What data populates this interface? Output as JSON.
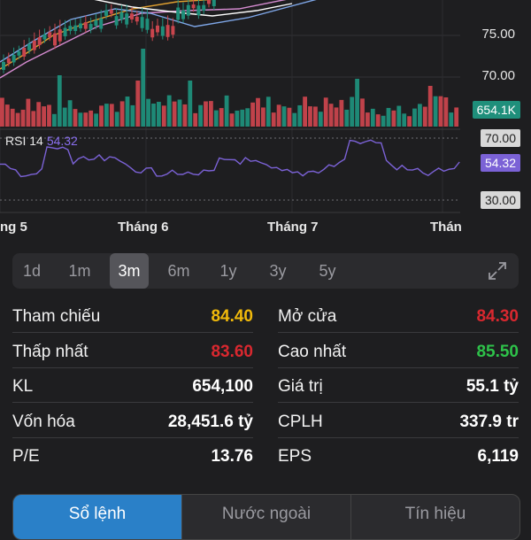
{
  "colors": {
    "up": "#1f8f7b",
    "down": "#c9454d",
    "rsi": "#7b62d6",
    "ref_yellow": "#f0b90b",
    "down_text": "#d9282f",
    "up_text": "#2ec24a",
    "active_blue": "#2a80c8"
  },
  "price_axis": {
    "labels": [
      "75.00",
      "70.00"
    ]
  },
  "volume_tag": "654.1K",
  "rsi": {
    "label": "RSI 14",
    "value": "54.32",
    "level_high": "70.00",
    "level_low": "30.00"
  },
  "months": [
    "ng 5",
    "Tháng 6",
    "Tháng 7",
    "Thán"
  ],
  "periods": [
    "1d",
    "1m",
    "3m",
    "6m",
    "1y",
    "3y",
    "5y"
  ],
  "active_period": "3m",
  "stats_left": [
    {
      "label": "Tham chiếu",
      "value": "84.40",
      "tone": "yellow"
    },
    {
      "label": "Thấp nhất",
      "value": "83.60",
      "tone": "red"
    },
    {
      "label": "KL",
      "value": "654,100",
      "tone": "white"
    },
    {
      "label": "Vốn hóa",
      "value": "28,451.6 tỷ",
      "tone": "white"
    },
    {
      "label": "P/E",
      "value": "13.76",
      "tone": "white"
    }
  ],
  "stats_right": [
    {
      "label": "Mở cửa",
      "value": "84.30",
      "tone": "red"
    },
    {
      "label": "Cao nhất",
      "value": "85.50",
      "tone": "green"
    },
    {
      "label": "Giá trị",
      "value": "55.1 tỷ",
      "tone": "white"
    },
    {
      "label": "CPLH",
      "value": "337.9 tr",
      "tone": "white"
    },
    {
      "label": "EPS",
      "value": "6,119",
      "tone": "white"
    }
  ],
  "tabs": [
    "Sổ lệnh",
    "Nước ngoài",
    "Tín hiệu"
  ],
  "active_tab": "Sổ lệnh"
}
